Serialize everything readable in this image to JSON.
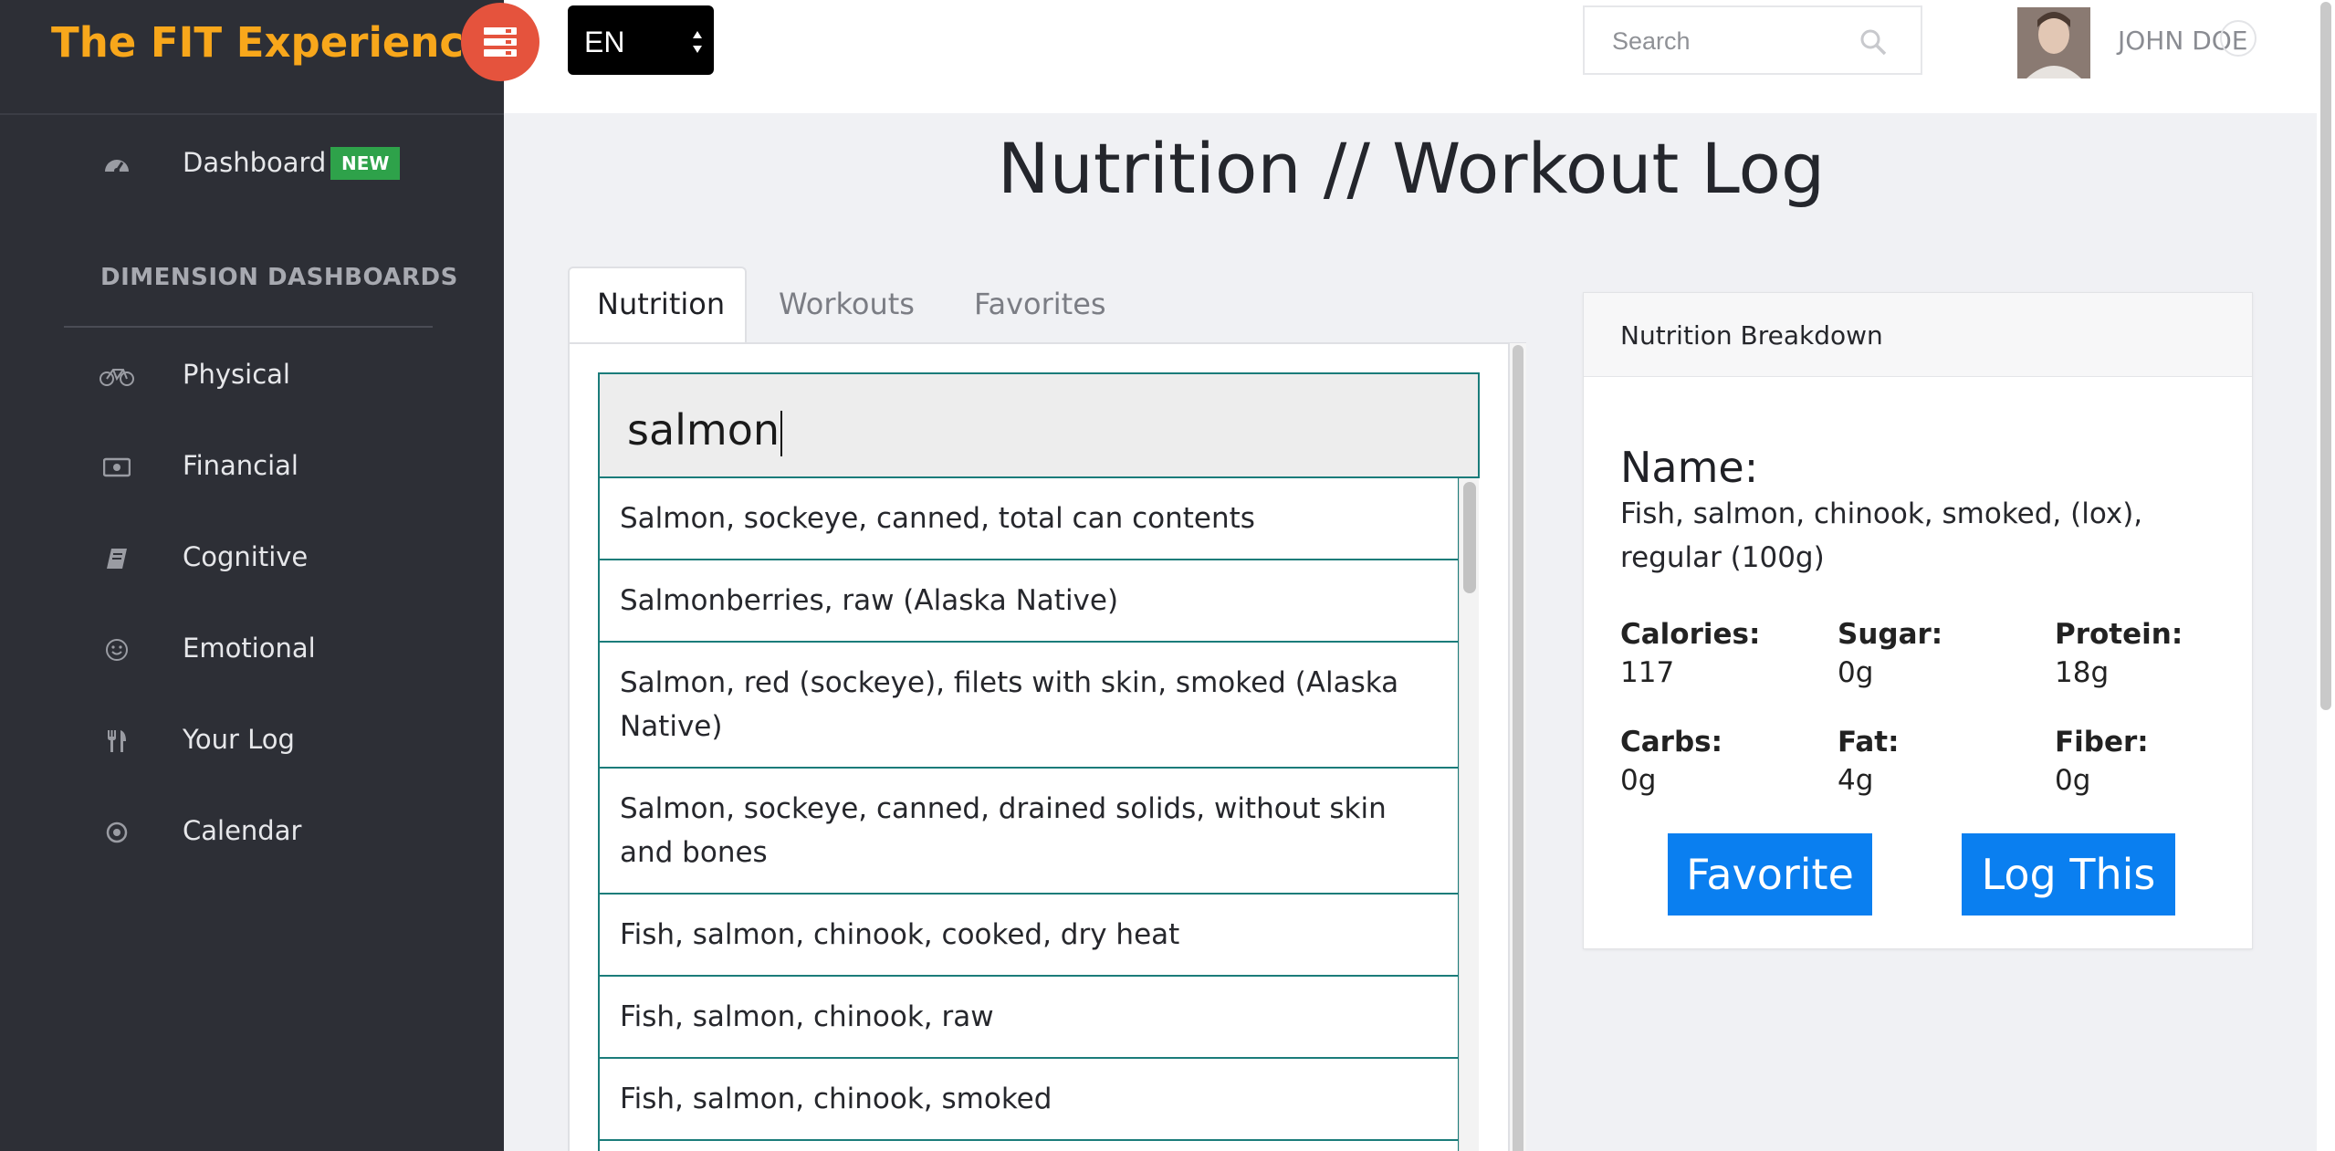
{
  "brand": {
    "title": "The FIT Experience",
    "accent": "#f8a71b",
    "toggle_color": "#e5533d",
    "toggle_icon": "server-menu-icon"
  },
  "sidebar": {
    "dashboard": {
      "label": "Dashboard",
      "badge": "NEW",
      "icon": "speedometer-icon"
    },
    "section_title": "DIMENSION DASHBOARDS",
    "items": [
      {
        "label": "Physical",
        "icon": "bicycle-icon"
      },
      {
        "label": "Financial",
        "icon": "money-icon"
      },
      {
        "label": "Cognitive",
        "icon": "book-icon"
      },
      {
        "label": "Emotional",
        "icon": "smiley-icon"
      },
      {
        "label": "Your Log",
        "icon": "cutlery-icon"
      },
      {
        "label": "Calendar",
        "icon": "target-icon"
      }
    ]
  },
  "topbar": {
    "language": "EN",
    "search_placeholder": "Search",
    "user_name": "JOHN DOE"
  },
  "page": {
    "title": "Nutrition // Workout Log"
  },
  "tabs": [
    {
      "label": "Nutrition",
      "active": true
    },
    {
      "label": "Workouts",
      "active": false
    },
    {
      "label": "Favorites",
      "active": false
    }
  ],
  "food_search": {
    "value": "salmon"
  },
  "results": [
    "Salmon, sockeye, canned, total can contents",
    "Salmonberries, raw (Alaska Native)",
    "Salmon, red (sockeye), filets with skin, smoked (Alaska Native)",
    "Salmon, sockeye, canned, drained solids, without skin and bones",
    "Fish, salmon, chinook, cooked, dry heat",
    "Fish, salmon, chinook, raw",
    "Fish, salmon, chinook, smoked"
  ],
  "breakdown": {
    "header": "Nutrition Breakdown",
    "name_label": "Name:",
    "name_value": "Fish, salmon, chinook, smoked, (lox), regular (100g)",
    "stats": [
      {
        "label": "Calories:",
        "value": "117"
      },
      {
        "label": "Sugar:",
        "value": "0g"
      },
      {
        "label": "Protein:",
        "value": "18g"
      },
      {
        "label": "Carbs:",
        "value": "0g"
      },
      {
        "label": "Fat:",
        "value": "4g"
      },
      {
        "label": "Fiber:",
        "value": "0g"
      }
    ],
    "favorite_label": "Favorite",
    "log_label": "Log This",
    "button_color": "#0a7ff0"
  }
}
